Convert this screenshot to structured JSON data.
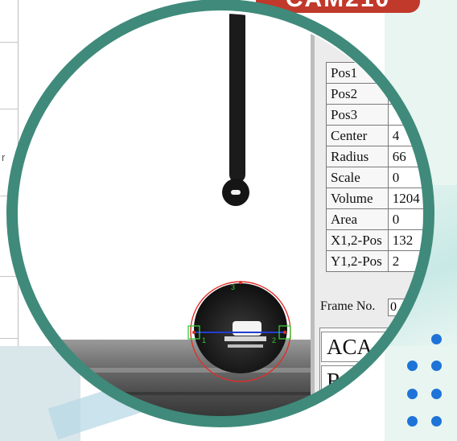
{
  "badge": {
    "text": "CAM210"
  },
  "left_panel": {
    "letter": "r"
  },
  "parameters": [
    {
      "label": "Pos1",
      "value": ""
    },
    {
      "label": "Pos2",
      "value": ""
    },
    {
      "label": "Pos3",
      "value": ""
    },
    {
      "label": "Center",
      "value": "4"
    },
    {
      "label": "Radius",
      "value": "66"
    },
    {
      "label": "Scale",
      "value": "0"
    },
    {
      "label": "Volume",
      "value": "1204"
    },
    {
      "label": "Area",
      "value": "0"
    },
    {
      "label": "X1,2-Pos",
      "value": "132"
    },
    {
      "label": "Y1,2-Pos",
      "value": "2"
    }
  ],
  "frame": {
    "label": "Frame No.",
    "value": "0"
  },
  "angles": [
    {
      "label": "ACA",
      "value": ""
    },
    {
      "label": "RCA",
      "value": ""
    }
  ],
  "markers": {
    "p1": "1",
    "p2": "2",
    "p3": "3"
  },
  "colors": {
    "ring": "#3f8a7b",
    "badge": "#c0392b",
    "fit_circle": "#e0302a",
    "baseline": "#1f3fd0",
    "markers": "#39c939",
    "dots": "#1e73d8"
  }
}
